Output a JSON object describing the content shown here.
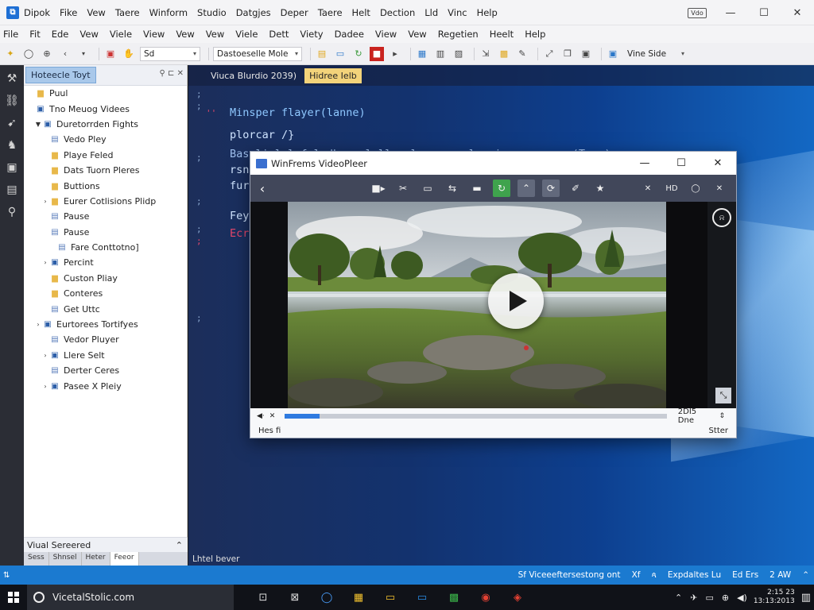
{
  "titlebar": {
    "logo_icon": "visual-studio-logo",
    "menu": [
      "Dipok",
      "Fike",
      "Vew",
      "Taere",
      "Winform",
      "Studio",
      "Datgjes",
      "Deper",
      "Taere",
      "Helt",
      "Dection",
      "Lld",
      "Vinc",
      "Help"
    ],
    "restore_chip": "Vdo",
    "min": "—",
    "max": "☐",
    "close": "✕"
  },
  "menubar": {
    "items": [
      "File",
      "Fit",
      "Ede",
      "Vew",
      "Viele",
      "View",
      "Vew",
      "Vew",
      "Viele",
      "Dett",
      "Viety",
      "Dadee",
      "View",
      "Vew",
      "Regetien",
      "Heelt",
      "Help"
    ]
  },
  "toolbar": {
    "combo1": "Sd",
    "combo2": "Dastoeselle Mole",
    "combo3": "Vine Side"
  },
  "explorer": {
    "tab": "Hoteecle Toyt",
    "header_icons": "⚲ ⊏ ✕",
    "items": [
      {
        "indent": 0,
        "arrow": "",
        "icon": "folder",
        "label": "Puul"
      },
      {
        "indent": 0,
        "arrow": "",
        "icon": "proj",
        "label": "Tno Meuog Videes"
      },
      {
        "indent": 1,
        "arrow": "▼",
        "icon": "proj",
        "label": "Duretorrden Fights"
      },
      {
        "indent": 2,
        "arrow": "",
        "icon": "file",
        "label": "Vedo Pley"
      },
      {
        "indent": 2,
        "arrow": "",
        "icon": "folder",
        "label": "Playe Feled"
      },
      {
        "indent": 2,
        "arrow": "",
        "icon": "folder",
        "label": "Dats Tuorn Pleres"
      },
      {
        "indent": 2,
        "arrow": "",
        "icon": "folder",
        "label": "Buttions"
      },
      {
        "indent": 2,
        "arrow": "›",
        "icon": "folder",
        "label": "Eurer Cotlisions Plidp"
      },
      {
        "indent": 2,
        "arrow": "",
        "icon": "file",
        "label": "Pause"
      },
      {
        "indent": 2,
        "arrow": "",
        "icon": "file",
        "label": "Pause"
      },
      {
        "indent": 3,
        "arrow": "",
        "icon": "file",
        "label": "Fare Conttotno]"
      },
      {
        "indent": 2,
        "arrow": "›",
        "icon": "proj",
        "label": "Percint"
      },
      {
        "indent": 2,
        "arrow": "",
        "icon": "folder",
        "label": "Custon Pliay"
      },
      {
        "indent": 2,
        "arrow": "",
        "icon": "folder",
        "label": "Conteres"
      },
      {
        "indent": 2,
        "arrow": "",
        "icon": "file",
        "label": "Get Uttc"
      },
      {
        "indent": 1,
        "arrow": "›",
        "icon": "proj",
        "label": "Eurtorees Tortifyes"
      },
      {
        "indent": 2,
        "arrow": "",
        "icon": "file",
        "label": "Vedor Pluyer"
      },
      {
        "indent": 2,
        "arrow": "›",
        "icon": "proj",
        "label": "Llere Selt"
      },
      {
        "indent": 2,
        "arrow": "",
        "icon": "file",
        "label": "Derter Ceres"
      },
      {
        "indent": 2,
        "arrow": "›",
        "icon": "proj",
        "label": "Pasee X Pleiy"
      }
    ],
    "footer_label": "Viual Sereered",
    "footer_chevron": "⌃",
    "footer_tabs": [
      "Sess",
      "Shnsel",
      "Heter",
      "Feeor"
    ]
  },
  "editor": {
    "tabs": [
      "Viuca Blurdio 2039)",
      "Hidree Ielb"
    ],
    "code": [
      {
        "text": "Minsper flayer(lanne)",
        "color": "#8fc8ff"
      },
      {
        "text": "plorcar /}",
        "color": "#cfe4ff"
      },
      {
        "text": "Baseliulel feledbe colpllegelgrasseeplas-ipenseeprers(Trep)",
        "color": "#9fc0ee"
      },
      {
        "text": "rsn",
        "color": "#cfe4ff"
      },
      {
        "text": "fur",
        "color": "#cfe4ff"
      },
      {
        "text": "Fey",
        "color": "#cfe4ff"
      },
      {
        "text": "Ecr",
        "color": "#e3476b"
      }
    ],
    "status_caption": "Lhtel bever"
  },
  "player": {
    "title": "WinFrems VideoPleer",
    "min": "—",
    "max": "☐",
    "close": "✕",
    "back": "‹",
    "tools": [
      {
        "icon": "record-icon",
        "glyph": "■▸",
        "style": ""
      },
      {
        "icon": "cut-icon",
        "glyph": "✂",
        "style": ""
      },
      {
        "icon": "frame-icon",
        "glyph": "▭",
        "style": ""
      },
      {
        "icon": "step-icon",
        "glyph": "⇆",
        "style": ""
      },
      {
        "icon": "folder-icon",
        "glyph": "▬",
        "style": ""
      },
      {
        "icon": "refresh-icon",
        "glyph": "↻",
        "style": "green"
      },
      {
        "icon": "curve-icon",
        "glyph": "⌃",
        "style": "grey"
      },
      {
        "icon": "loop-icon",
        "glyph": "⟳",
        "style": "grey"
      },
      {
        "icon": "wand-icon",
        "glyph": "✐",
        "style": ""
      },
      {
        "icon": "star-icon",
        "glyph": "★",
        "style": ""
      }
    ],
    "right_tools": [
      {
        "icon": "mute-icon",
        "glyph": "✕"
      },
      {
        "icon": "hd-icon",
        "glyph": "HD"
      },
      {
        "icon": "settings-icon",
        "glyph": "◯"
      },
      {
        "icon": "close-panel-icon",
        "glyph": "✕"
      }
    ],
    "progress": 0.09,
    "time": "2DI5 Dne",
    "left_label": "Hes fi",
    "right_label": "Stter",
    "volume_glyph": "◀·",
    "mute_glyph": "✕"
  },
  "statusbar": {
    "left": "",
    "items": [
      "Sf Viceeeftersestong ont",
      "Xf",
      "ጳ",
      "Expdaltes Lu",
      "Ed Ers",
      "2 AW",
      "⌃"
    ]
  },
  "taskbar": {
    "search_text": "VicetalStolic.com",
    "task_glyphs": [
      "⊡",
      "⊠",
      "◯",
      "▦",
      "▭",
      "▭",
      "▩",
      "◉",
      "◈"
    ],
    "tray": [
      "⌃",
      "✈",
      "▭",
      "⊕",
      "◀)"
    ],
    "clock_line1": "2:15 23",
    "clock_line2": "13:13:2013",
    "notif": "▥"
  }
}
